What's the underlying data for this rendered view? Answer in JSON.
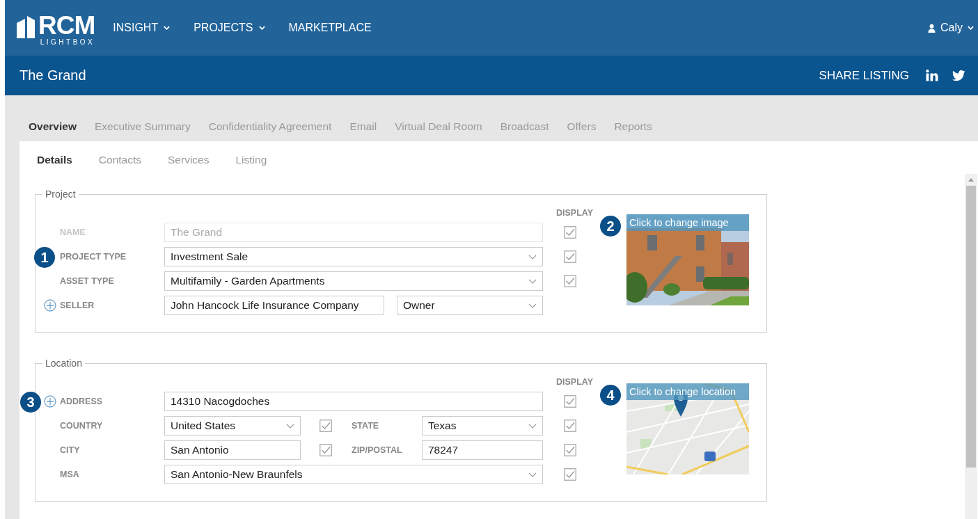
{
  "logo": {
    "primary": "RCM",
    "secondary": "LIGHTBOX"
  },
  "nav": [
    {
      "label": "INSIGHT",
      "dropdown": true
    },
    {
      "label": "PROJECTS",
      "dropdown": true
    },
    {
      "label": "MARKETPLACE",
      "dropdown": false
    }
  ],
  "user": {
    "name": "Caly"
  },
  "title_bar": {
    "title": "The Grand",
    "share": "SHARE LISTING"
  },
  "tabs": [
    {
      "label": "Overview",
      "selected": true
    },
    {
      "label": "Executive Summary",
      "selected": false
    },
    {
      "label": "Confidentiality Agreement",
      "selected": false
    },
    {
      "label": "Email",
      "selected": false
    },
    {
      "label": "Virtual Deal Room",
      "selected": false
    },
    {
      "label": "Broadcast",
      "selected": false
    },
    {
      "label": "Offers",
      "selected": false
    },
    {
      "label": "Reports",
      "selected": false
    }
  ],
  "subtabs": [
    {
      "label": "Details",
      "selected": true
    },
    {
      "label": "Contacts",
      "selected": false
    },
    {
      "label": "Services",
      "selected": false
    },
    {
      "label": "Listing",
      "selected": false
    }
  ],
  "sections": [
    {
      "legend": "Project",
      "display_header": "DISPLAY",
      "media": {
        "caption": "Click to change image",
        "badge": "2"
      },
      "rows": [
        {
          "label": "NAME",
          "disabled": true,
          "parts": [
            {
              "kind": "input",
              "value": "The Grand"
            }
          ],
          "display_checked": true
        },
        {
          "label": "PROJECT TYPE",
          "badge": "1",
          "disabled": false,
          "parts": [
            {
              "kind": "select",
              "value": "Investment Sale"
            }
          ],
          "display_checked": true
        },
        {
          "label": "ASSET TYPE",
          "disabled": false,
          "parts": [
            {
              "kind": "select",
              "value": "Multifamily - Garden Apartments"
            }
          ],
          "display_checked": true
        },
        {
          "label": "SELLER",
          "disabled": false,
          "add": true,
          "parts": [
            {
              "kind": "input",
              "value": "John Hancock Life Insurance Company"
            },
            {
              "kind": "select",
              "value": "Owner"
            }
          ]
        }
      ]
    },
    {
      "legend": "Location",
      "display_header": "DISPLAY",
      "media": {
        "kind": "map",
        "caption": "Click to change location",
        "badge": "4"
      },
      "rows": [
        {
          "label": "ADDRESS",
          "badge": "3",
          "disabled": false,
          "add": true,
          "parts": [
            {
              "kind": "input",
              "value": "14310 Nacogdoches"
            }
          ],
          "display_checked": true
        },
        {
          "label": "COUNTRY",
          "disabled": false,
          "parts": [
            {
              "kind": "select",
              "value": "United States"
            },
            {
              "kind": "check",
              "checked": true
            },
            {
              "kind": "label",
              "text": "STATE"
            },
            {
              "kind": "select",
              "value": "Texas"
            }
          ],
          "display_checked": true
        },
        {
          "label": "CITY",
          "disabled": false,
          "parts": [
            {
              "kind": "input",
              "value": "San Antonio"
            },
            {
              "kind": "check",
              "checked": true
            },
            {
              "kind": "label",
              "text": "ZIP/POSTAL"
            },
            {
              "kind": "input",
              "value": "78247"
            }
          ],
          "display_checked": true
        },
        {
          "label": "MSA",
          "disabled": false,
          "parts": [
            {
              "kind": "select",
              "value": "San Antonio-New Braunfels"
            }
          ],
          "display_checked": true
        }
      ]
    }
  ]
}
